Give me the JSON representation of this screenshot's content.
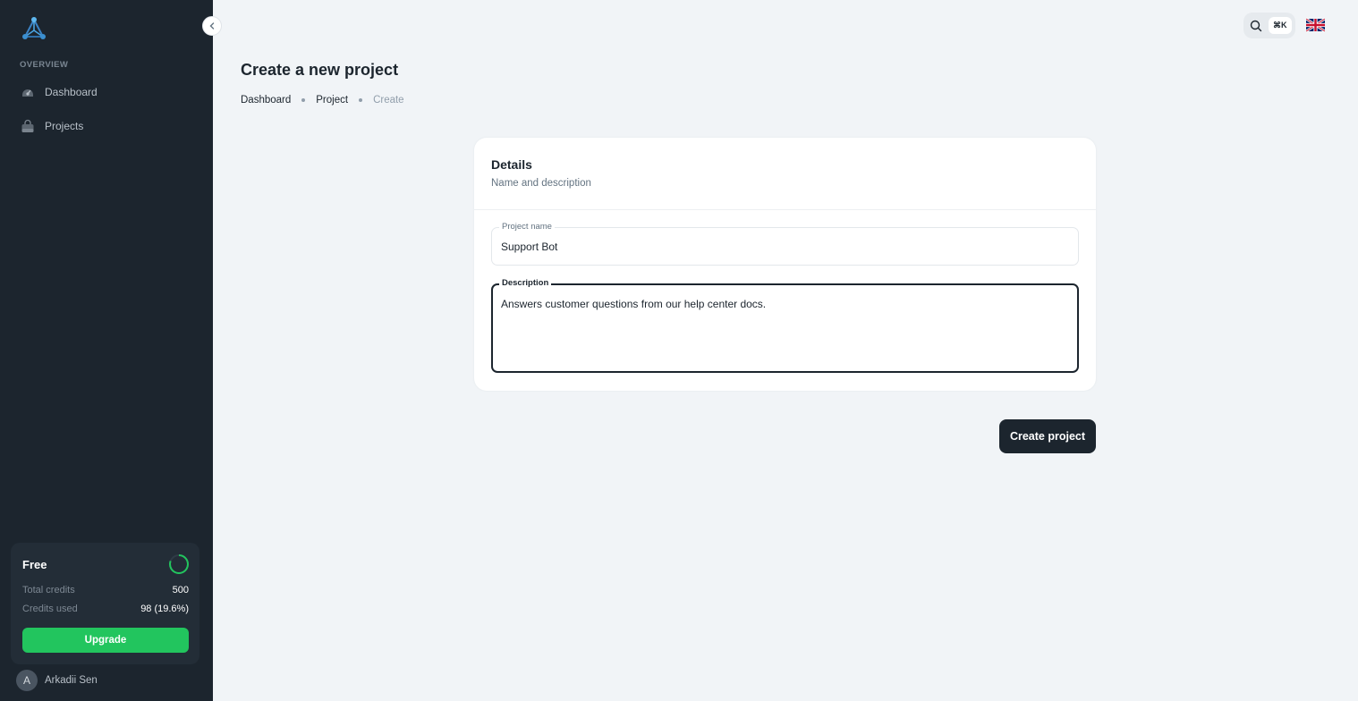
{
  "sidebar": {
    "section_label": "OVERVIEW",
    "items": [
      {
        "label": "Dashboard",
        "icon": "dashboard-icon"
      },
      {
        "label": "Projects",
        "icon": "bag-icon"
      }
    ],
    "plan": {
      "name": "Free",
      "total_credits_label": "Total credits",
      "total_credits_value": "500",
      "credits_used_label": "Credits used",
      "credits_used_value": "98 (19.6%)",
      "usage_fraction": 0.196,
      "upgrade_label": "Upgrade",
      "accent_color": "#22c55e"
    },
    "user": {
      "initial": "A",
      "name": "Arkadii Sen"
    }
  },
  "topbar": {
    "search_shortcut": "⌘K",
    "language_flag": "uk-flag-icon"
  },
  "header": {
    "title": "Create a new project",
    "breadcrumbs": [
      "Dashboard",
      "Project",
      "Create"
    ]
  },
  "form": {
    "section_title": "Details",
    "section_subtitle": "Name and description",
    "project_name_label": "Project name",
    "project_name_value": "Support Bot",
    "description_label": "Description",
    "description_value": "Answers customer questions from our help center docs.",
    "submit_label": "Create project"
  }
}
